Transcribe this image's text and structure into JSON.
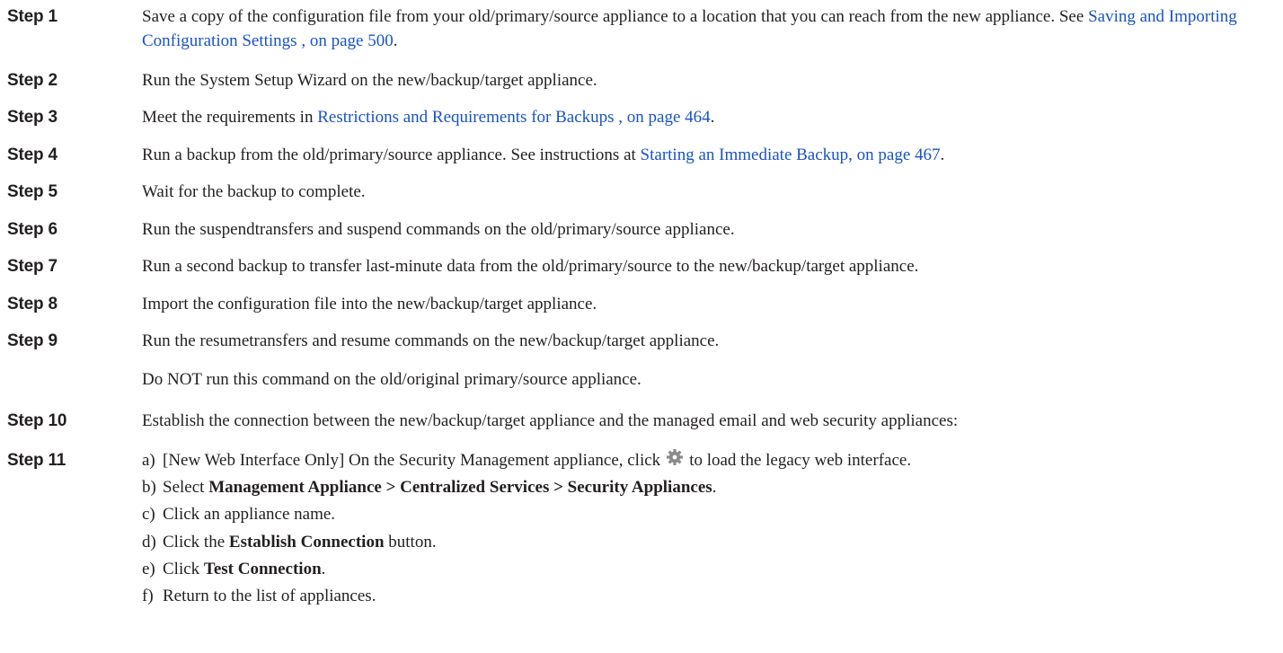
{
  "steps": [
    {
      "label": "Step 1",
      "pre": "Save a copy of the configuration file from your old/primary/source appliance to a location that you can reach from the new appliance. See ",
      "link": "Saving and Importing Configuration Settings , on page 500",
      "post": "."
    },
    {
      "label": "Step 2",
      "text": "Run the System Setup Wizard on the new/backup/target appliance."
    },
    {
      "label": "Step 3",
      "pre": "Meet the requirements in ",
      "link": "Restrictions and Requirements for Backups , on page 464",
      "post": "."
    },
    {
      "label": "Step 4",
      "pre": "Run a backup from the old/primary/source appliance. See instructions at ",
      "link": "Starting an Immediate Backup, on page 467",
      "post": "."
    },
    {
      "label": "Step 5",
      "text": "Wait for the backup to complete."
    },
    {
      "label": "Step 6",
      "text": "Run the suspendtransfers and suspend commands on the old/primary/source appliance."
    },
    {
      "label": "Step 7",
      "text": "Run a second backup to transfer last-minute data from the old/primary/source to the new/backup/target appliance."
    },
    {
      "label": "Step 8",
      "text": "Import the configuration file into the new/backup/target appliance."
    },
    {
      "label": "Step 9",
      "text": "Run the resumetransfers and resume commands on the new/backup/target appliance.",
      "note": "Do NOT run this command on the old/original primary/source appliance."
    },
    {
      "label": "Step 10",
      "text": "Establish the connection between the new/backup/target appliance and the managed email and web security appliances:"
    },
    {
      "label": "Step 11"
    }
  ],
  "substeps": {
    "a": {
      "marker": "a)",
      "pre": "[New Web Interface Only] On the Security Management appliance, click",
      "icon": "gear-icon",
      "post": "to load the legacy web interface."
    },
    "b": {
      "marker": "b)",
      "pre": "Select ",
      "bold": "Management Appliance > Centralized Services > Security Appliances",
      "post": "."
    },
    "c": {
      "marker": "c)",
      "text": "Click an appliance name."
    },
    "d": {
      "marker": "d)",
      "pre": "Click the ",
      "bold": "Establish Connection",
      "post": " button."
    },
    "e": {
      "marker": "e)",
      "pre": "Click ",
      "bold": "Test Connection",
      "post": "."
    },
    "f": {
      "marker": "f)",
      "text": "Return to the list of appliances."
    }
  },
  "colors": {
    "text": "#231f20",
    "link": "#1a53c5",
    "icon": "#8a8a8a"
  }
}
